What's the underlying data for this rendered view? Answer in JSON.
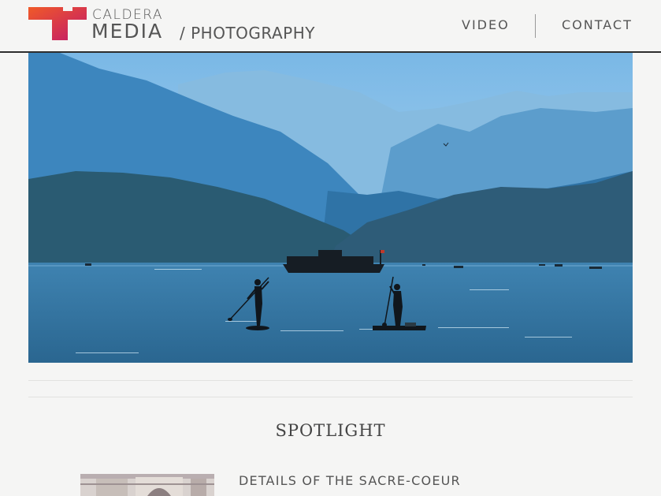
{
  "header": {
    "brand_top": "CALDERA",
    "brand_bottom": "MEDIA",
    "brand_sub": "/ PHOTOGRAPHY",
    "nav": [
      {
        "label": "VIDEO"
      },
      {
        "label": "CONTACT"
      }
    ]
  },
  "colors": {
    "logo_gradient_start": "#f05a28",
    "logo_gradient_end": "#c2186b",
    "header_rule": "#2e2e2e",
    "sky": "#7ab8e6",
    "water": "#2f6f9c"
  },
  "hero": {
    "subject": "paddleboarders-on-lake-with-mountains"
  },
  "spotlight": {
    "title": "SPOTLIGHT",
    "posts": [
      {
        "title": "DETAILS OF THE SACRE-COEUR"
      }
    ]
  }
}
